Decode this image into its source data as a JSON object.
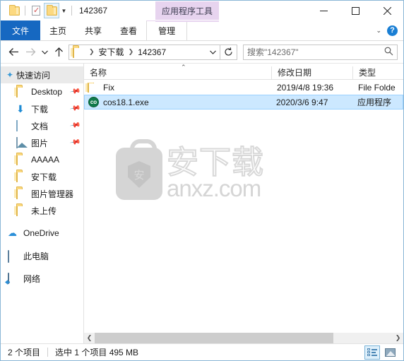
{
  "titlebar": {
    "title": "142367",
    "contextual_label": "应用程序工具",
    "qat": [
      {
        "name": "new-folder",
        "icon": "folder-icon"
      },
      {
        "name": "properties",
        "icon": "properties-icon"
      },
      {
        "name": "current-folder",
        "icon": "folder-icon"
      }
    ],
    "controls": {
      "minimize": "minimize-icon",
      "maximize": "maximize-icon",
      "close": "close-icon"
    }
  },
  "ribbon": {
    "tabs": [
      {
        "label": "文件",
        "kind": "file"
      },
      {
        "label": "主页",
        "kind": "normal"
      },
      {
        "label": "共享",
        "kind": "normal"
      },
      {
        "label": "查看",
        "kind": "normal"
      },
      {
        "label": "管理",
        "kind": "contextual"
      }
    ],
    "expand_icon": "chevron-down-icon",
    "help_label": "?"
  },
  "addressbar": {
    "back_icon": "arrow-left-icon",
    "forward_icon": "arrow-right-icon",
    "recent_icon": "chevron-down-icon",
    "up_icon": "arrow-up-icon",
    "breadcrumbs": [
      "安下载",
      "142367"
    ],
    "dropdown_icon": "chevron-down-icon",
    "refresh_icon": "refresh-icon"
  },
  "search": {
    "placeholder": "搜索\"142367\"",
    "icon": "search-icon"
  },
  "sidebar": {
    "items": [
      {
        "label": "快速访问",
        "icon": "star-icon",
        "level": "header",
        "pinned": false
      },
      {
        "label": "Desktop",
        "icon": "folder-icon",
        "level": "child",
        "pinned": true
      },
      {
        "label": "下载",
        "icon": "download-icon",
        "level": "child",
        "pinned": true
      },
      {
        "label": "文档",
        "icon": "document-icon",
        "level": "child",
        "pinned": true
      },
      {
        "label": "图片",
        "icon": "picture-icon",
        "level": "child",
        "pinned": true
      },
      {
        "label": "AAAAA",
        "icon": "folder-icon",
        "level": "child",
        "pinned": false
      },
      {
        "label": "安下载",
        "icon": "folder-icon",
        "level": "child",
        "pinned": false
      },
      {
        "label": "图片管理器",
        "icon": "folder-icon",
        "level": "child",
        "pinned": false
      },
      {
        "label": "未上传",
        "icon": "folder-icon",
        "level": "child",
        "pinned": false
      },
      {
        "label": "OneDrive",
        "icon": "cloud-icon",
        "level": "root",
        "pinned": false
      },
      {
        "label": "此电脑",
        "icon": "computer-icon",
        "level": "root",
        "pinned": false
      },
      {
        "label": "网络",
        "icon": "network-icon",
        "level": "root",
        "pinned": false
      }
    ]
  },
  "filelist": {
    "columns": [
      {
        "label": "名称",
        "sorted": "asc"
      },
      {
        "label": "修改日期",
        "sorted": ""
      },
      {
        "label": "类型",
        "sorted": ""
      }
    ],
    "rows": [
      {
        "name": "Fix",
        "date": "2019/4/8 19:36",
        "type": "File Folde",
        "icon": "folder-icon",
        "selected": false
      },
      {
        "name": "cos18.1.exe",
        "date": "2020/3/6 9:47",
        "type": "应用程序",
        "icon": "exe-icon",
        "icon_text": "co",
        "selected": true
      }
    ]
  },
  "watermark": {
    "chinese": "安下载",
    "domain": "anxz.com",
    "badge_char": "安"
  },
  "statusbar": {
    "item_count": "2 个项目",
    "selection": "选中 1 个项目  495 MB",
    "views": [
      {
        "name": "details-view",
        "active": true
      },
      {
        "name": "large-icons-view",
        "active": false
      }
    ]
  },
  "colors": {
    "accent": "#1668c1",
    "selection": "#cce8ff",
    "contextual": "#e7d4ef"
  }
}
